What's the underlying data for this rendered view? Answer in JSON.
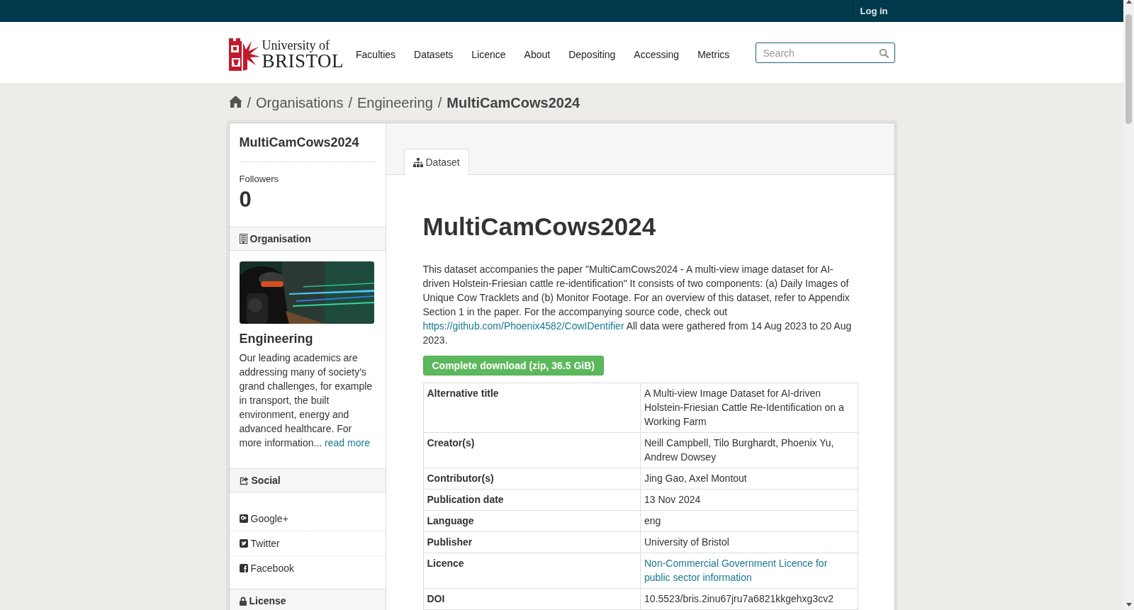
{
  "top_bar": {
    "login": "Log in"
  },
  "header": {
    "logo": {
      "line1": "University of",
      "line2": "BRISTOL"
    },
    "nav": [
      "Faculties",
      "Datasets",
      "Licence",
      "About",
      "Depositing",
      "Accessing",
      "Metrics"
    ],
    "search": {
      "placeholder": "Search"
    }
  },
  "breadcrumb": [
    {
      "separator": "/",
      "label": "Organisations",
      "current": false
    },
    {
      "separator": "/",
      "label": "Engineering",
      "current": false
    },
    {
      "separator": "/",
      "label": "MultiCamCows2024",
      "current": true
    }
  ],
  "sidebar": {
    "title": "MultiCamCows2024",
    "followers_label": "Followers",
    "followers_count": "0",
    "organisation": {
      "heading": "Organisation",
      "name": "Engineering",
      "description": "Our leading academics are addressing many of society's grand challenges, for example in transport, the built environment, energy and advanced healthcare. For more information...",
      "link": "read more"
    },
    "social": {
      "heading": "Social",
      "links": [
        {
          "kind": "googleplus",
          "label": "Google+"
        },
        {
          "kind": "twitter",
          "label": "Twitter"
        },
        {
          "kind": "facebook",
          "label": "Facebook"
        }
      ]
    },
    "license": {
      "heading": "License"
    }
  },
  "tabs": [
    {
      "label": "Dataset",
      "selected": true
    }
  ],
  "dataset": {
    "title": "MultiCamCows2024",
    "description": "This dataset accompanies the paper \"MultiCamCows2024 - A multi-view image dataset for AI-driven Holstein-Friesian cattle re-identification\" It consists of two components: (a) Daily Images of Unique Cow Tracklets and (b) Monitor Footage. For an overview of this dataset, refer to Appendix Section 1 in the paper. For the accompanying source code, check out",
    "link": "https://github.com/Phoenix4582/CowIDentifier",
    "description_end": "All data were gathered from 14 Aug 2023 to 20 Aug 2023.",
    "download": "Complete download (zip, 36.5 GiB)",
    "table": [
      {
        "label": "Alternative title",
        "value": "A Multi-view Image Dataset for AI-driven Holstein-Friesian Cattle Re-Identification on a Working Farm",
        "kind": "text"
      },
      {
        "label": "Creator(s)",
        "value": "Neill Campbell, Tilo Burghardt, Phoenix Yu, Andrew Dowsey",
        "kind": "text"
      },
      {
        "label": "Contributor(s)",
        "value": "Jing Gao, Axel Montout",
        "kind": "text"
      },
      {
        "label": "Publication date",
        "value": "13 Nov 2024",
        "kind": "text"
      },
      {
        "label": "Language",
        "value": "eng",
        "kind": "text"
      },
      {
        "label": "Publisher",
        "value": "University of Bristol",
        "kind": "text"
      },
      {
        "label": "Licence",
        "value": "Non-Commercial Government Licence for public sector information",
        "kind": "link"
      },
      {
        "label": "DOI",
        "value": "10.5523/bris.2inu67jru7a6821kkgehxg3cv2",
        "kind": "text"
      }
    ]
  }
}
